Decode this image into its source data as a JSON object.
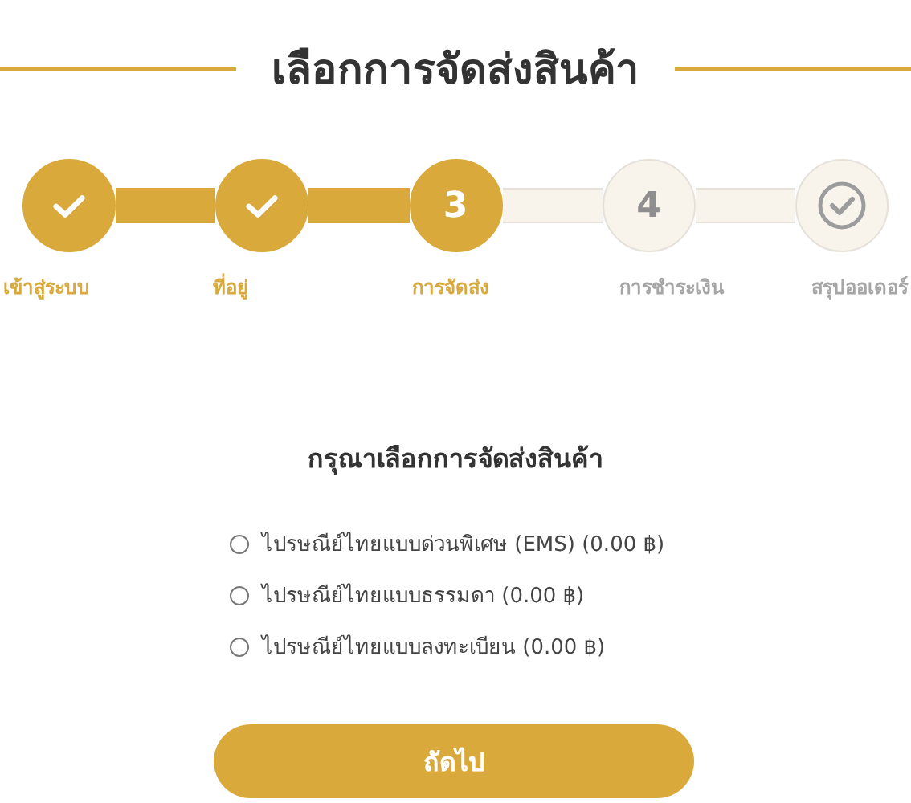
{
  "title": "เลือกการจัดส่งสินค้า",
  "steps": [
    {
      "kind": "check",
      "label": "เข้าสู่ระบบ",
      "done": true,
      "current": false
    },
    {
      "kind": "check",
      "label": "ที่อยู่",
      "done": true,
      "current": false
    },
    {
      "kind": "number",
      "number": "3",
      "label": "การจัดส่ง",
      "done": false,
      "current": true
    },
    {
      "kind": "number",
      "number": "4",
      "label": "การชำระเงิน",
      "done": false,
      "current": false
    },
    {
      "kind": "check",
      "label": "สรุปออเดอร์",
      "done": false,
      "current": false
    }
  ],
  "prompt": "กรุณาเลือกการจัดส่งสินค้า",
  "options": [
    {
      "label": "ไปรษณีย์ไทยแบบด่วนพิเศษ (EMS) (0.00 ฿)",
      "selected": false
    },
    {
      "label": "ไปรษณีย์ไทยแบบธรรมดา (0.00 ฿)",
      "selected": false
    },
    {
      "label": "ไปรษณีย์ไทยแบบลงทะเบียน (0.00 ฿)",
      "selected": false
    }
  ],
  "next_button": "ถัดไป"
}
